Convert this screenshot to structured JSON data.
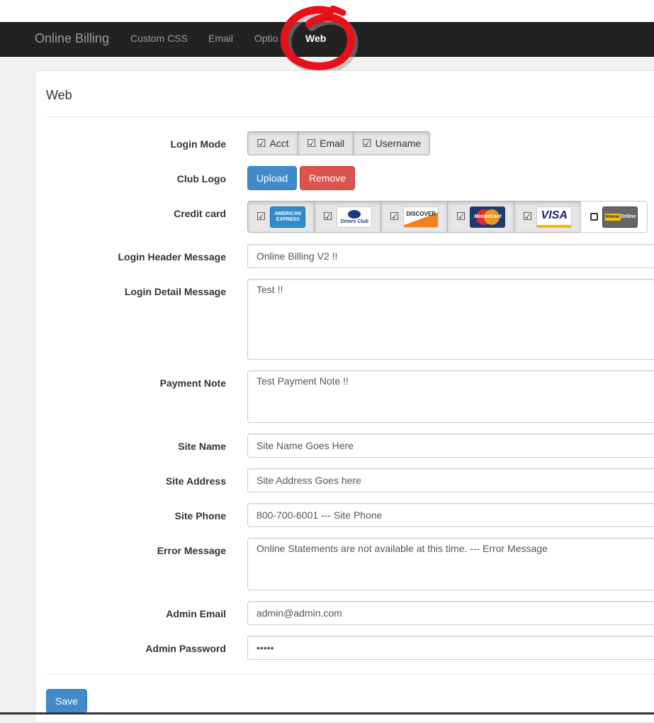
{
  "navbar": {
    "brand": "Online Billing",
    "items": [
      {
        "label": "Custom CSS"
      },
      {
        "label": "Email"
      },
      {
        "label": "Optio"
      },
      {
        "label": "Web"
      }
    ]
  },
  "panel": {
    "title": "Web"
  },
  "login_mode": {
    "label": "Login Mode",
    "options": [
      {
        "label": "Acct",
        "checked": true
      },
      {
        "label": "Email",
        "checked": true
      },
      {
        "label": "Username",
        "checked": true
      }
    ]
  },
  "club_logo": {
    "label": "Club Logo",
    "upload": "Upload",
    "remove": "Remove"
  },
  "credit_card": {
    "label": "Credit card",
    "cards": [
      {
        "name": "american-express",
        "text": "AMERICAN EXPRESS",
        "checked": true
      },
      {
        "name": "diners-club",
        "text": "Diners Club",
        "checked": true
      },
      {
        "name": "discover",
        "text": "DISCOVER",
        "checked": true
      },
      {
        "name": "mastercard",
        "text": "MasterCard",
        "checked": true
      },
      {
        "name": "visa",
        "text": "VISA",
        "checked": true
      },
      {
        "name": "interac",
        "text": "Interac Online",
        "checked": false
      }
    ]
  },
  "fields": {
    "login_header": {
      "label": "Login Header Message",
      "value": "Online Billing V2  !!"
    },
    "login_detail": {
      "label": "Login Detail Message",
      "value": "Test !!"
    },
    "payment_note": {
      "label": "Payment Note",
      "value": "Test Payment Note  !!"
    },
    "site_name": {
      "label": "Site Name",
      "value": "Site Name Goes Here"
    },
    "site_address": {
      "label": "Site Address",
      "value": "Site Address Goes here"
    },
    "site_phone": {
      "label": "Site Phone",
      "value": "800-700-6001 ---  Site Phone"
    },
    "error_message": {
      "label": "Error Message",
      "value": "Online Statements are not available at this time. ---   Error Message"
    },
    "admin_email": {
      "label": "Admin Email",
      "value": "admin@admin.com"
    },
    "admin_password": {
      "label": "Admin Password",
      "value": "•••••"
    }
  },
  "save": "Save",
  "colors": {
    "navbar": "#222222",
    "primary": "#428bca",
    "danger": "#d9534f",
    "annotation": "#e8101a"
  }
}
